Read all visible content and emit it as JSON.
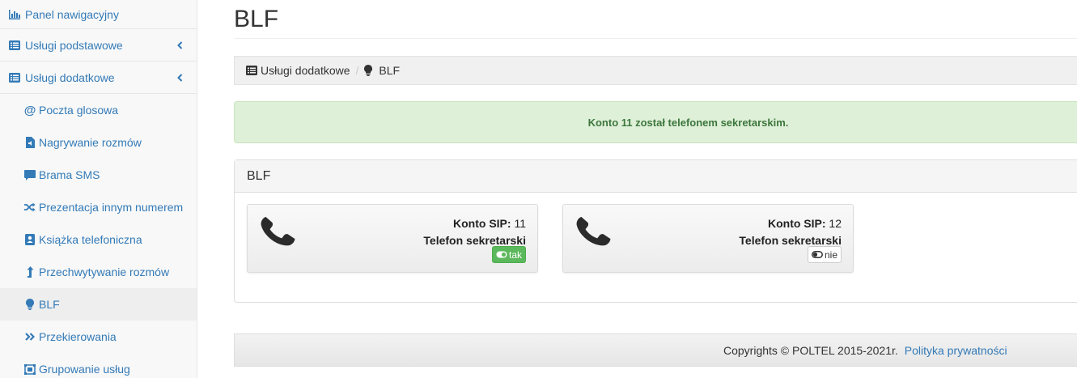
{
  "sidebar": {
    "top_items": [
      {
        "label": "Panel nawigacyjny",
        "icon": "bar-chart-icon"
      },
      {
        "label": "Usługi podstawowe",
        "icon": "list-icon"
      },
      {
        "label": "Usługi dodatkowe",
        "icon": "list-icon"
      }
    ],
    "sub_items": [
      {
        "label": "Poczta glosowa",
        "icon": "at-sign-icon"
      },
      {
        "label": "Nagrywanie rozmów",
        "icon": "audio-file-icon"
      },
      {
        "label": "Brama SMS",
        "icon": "comment-icon"
      },
      {
        "label": "Prezentacja innym numerem",
        "icon": "shuffle-icon"
      },
      {
        "label": "Książka telefoniczna",
        "icon": "contact-book-icon"
      },
      {
        "label": "Przechwytywanie rozmów",
        "icon": "arrow-up-icon"
      },
      {
        "label": "BLF",
        "icon": "lightbulb-icon"
      },
      {
        "label": "Przekierowania",
        "icon": "double-chevron-right-icon"
      },
      {
        "label": "Grupowanie usług",
        "icon": "object-group-icon"
      }
    ],
    "active_item": "BLF"
  },
  "page": {
    "title": "BLF"
  },
  "breadcrumb": {
    "items": [
      "Usługi dodatkowe",
      "BLF"
    ],
    "separator": "/"
  },
  "alert": {
    "message": "Konto 11 został telefonem sekretarskim."
  },
  "panel": {
    "heading": "BLF",
    "cards": [
      {
        "sip_label": "Konto SIP:",
        "sip_value": "11",
        "secretary_label": "Telefon sekretarski",
        "toggle_label": "tak",
        "toggle_state": "on"
      },
      {
        "sip_label": "Konto SIP:",
        "sip_value": "12",
        "secretary_label": "Telefon sekretarski",
        "toggle_label": "nie",
        "toggle_state": "off"
      }
    ]
  },
  "footer": {
    "copyright": "Copyrights © POLTEL 2015-2021r.",
    "privacy_link": "Polityka prywatności"
  },
  "colors": {
    "link": "#337ab7",
    "alert_bg": "#dff0d8",
    "alert_text": "#3c763d",
    "toggle_on": "#5cb85c"
  }
}
